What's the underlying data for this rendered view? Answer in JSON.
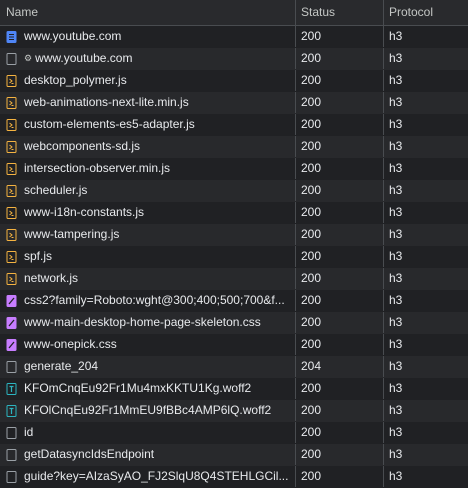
{
  "columns": {
    "name": "Name",
    "status": "Status",
    "protocol": "Protocol"
  },
  "colors": {
    "document": "#4f86f7",
    "script": "#f5b341",
    "stylesheet": "#c77dff",
    "font": "#2cb5c1",
    "other": "#9aa0a6"
  },
  "rows": [
    {
      "name": "www.youtube.com",
      "status": "200",
      "protocol": "h3",
      "icon": "document-icon",
      "gear": false
    },
    {
      "name": "www.youtube.com",
      "status": "200",
      "protocol": "h3",
      "icon": "blank-file-icon",
      "gear": true
    },
    {
      "name": "desktop_polymer.js",
      "status": "200",
      "protocol": "h3",
      "icon": "script-icon",
      "gear": false
    },
    {
      "name": "web-animations-next-lite.min.js",
      "status": "200",
      "protocol": "h3",
      "icon": "script-icon",
      "gear": false
    },
    {
      "name": "custom-elements-es5-adapter.js",
      "status": "200",
      "protocol": "h3",
      "icon": "script-icon",
      "gear": false
    },
    {
      "name": "webcomponents-sd.js",
      "status": "200",
      "protocol": "h3",
      "icon": "script-icon",
      "gear": false
    },
    {
      "name": "intersection-observer.min.js",
      "status": "200",
      "protocol": "h3",
      "icon": "script-icon",
      "gear": false
    },
    {
      "name": "scheduler.js",
      "status": "200",
      "protocol": "h3",
      "icon": "script-icon",
      "gear": false
    },
    {
      "name": "www-i18n-constants.js",
      "status": "200",
      "protocol": "h3",
      "icon": "script-icon",
      "gear": false
    },
    {
      "name": "www-tampering.js",
      "status": "200",
      "protocol": "h3",
      "icon": "script-icon",
      "gear": false
    },
    {
      "name": "spf.js",
      "status": "200",
      "protocol": "h3",
      "icon": "script-icon",
      "gear": false
    },
    {
      "name": "network.js",
      "status": "200",
      "protocol": "h3",
      "icon": "script-icon",
      "gear": false
    },
    {
      "name": "css2?family=Roboto:wght@300;400;500;700&f...",
      "status": "200",
      "protocol": "h3",
      "icon": "stylesheet-icon",
      "gear": false
    },
    {
      "name": "www-main-desktop-home-page-skeleton.css",
      "status": "200",
      "protocol": "h3",
      "icon": "stylesheet-icon",
      "gear": false
    },
    {
      "name": "www-onepick.css",
      "status": "200",
      "protocol": "h3",
      "icon": "stylesheet-icon",
      "gear": false
    },
    {
      "name": "generate_204",
      "status": "204",
      "protocol": "h3",
      "icon": "blank-file-icon",
      "gear": false
    },
    {
      "name": "KFOmCnqEu92Fr1Mu4mxKKTU1Kg.woff2",
      "status": "200",
      "protocol": "h3",
      "icon": "font-icon",
      "gear": false
    },
    {
      "name": "KFOlCnqEu92Fr1MmEU9fBBc4AMP6lQ.woff2",
      "status": "200",
      "protocol": "h3",
      "icon": "font-icon",
      "gear": false
    },
    {
      "name": "id",
      "status": "200",
      "protocol": "h3",
      "icon": "blank-file-icon",
      "gear": false
    },
    {
      "name": "getDatasyncIdsEndpoint",
      "status": "200",
      "protocol": "h3",
      "icon": "blank-file-icon",
      "gear": false
    },
    {
      "name": "guide?key=AIzaSyAO_FJ2SlqU8Q4STEHLGCil...",
      "status": "200",
      "protocol": "h3",
      "icon": "blank-file-icon",
      "gear": false
    }
  ]
}
